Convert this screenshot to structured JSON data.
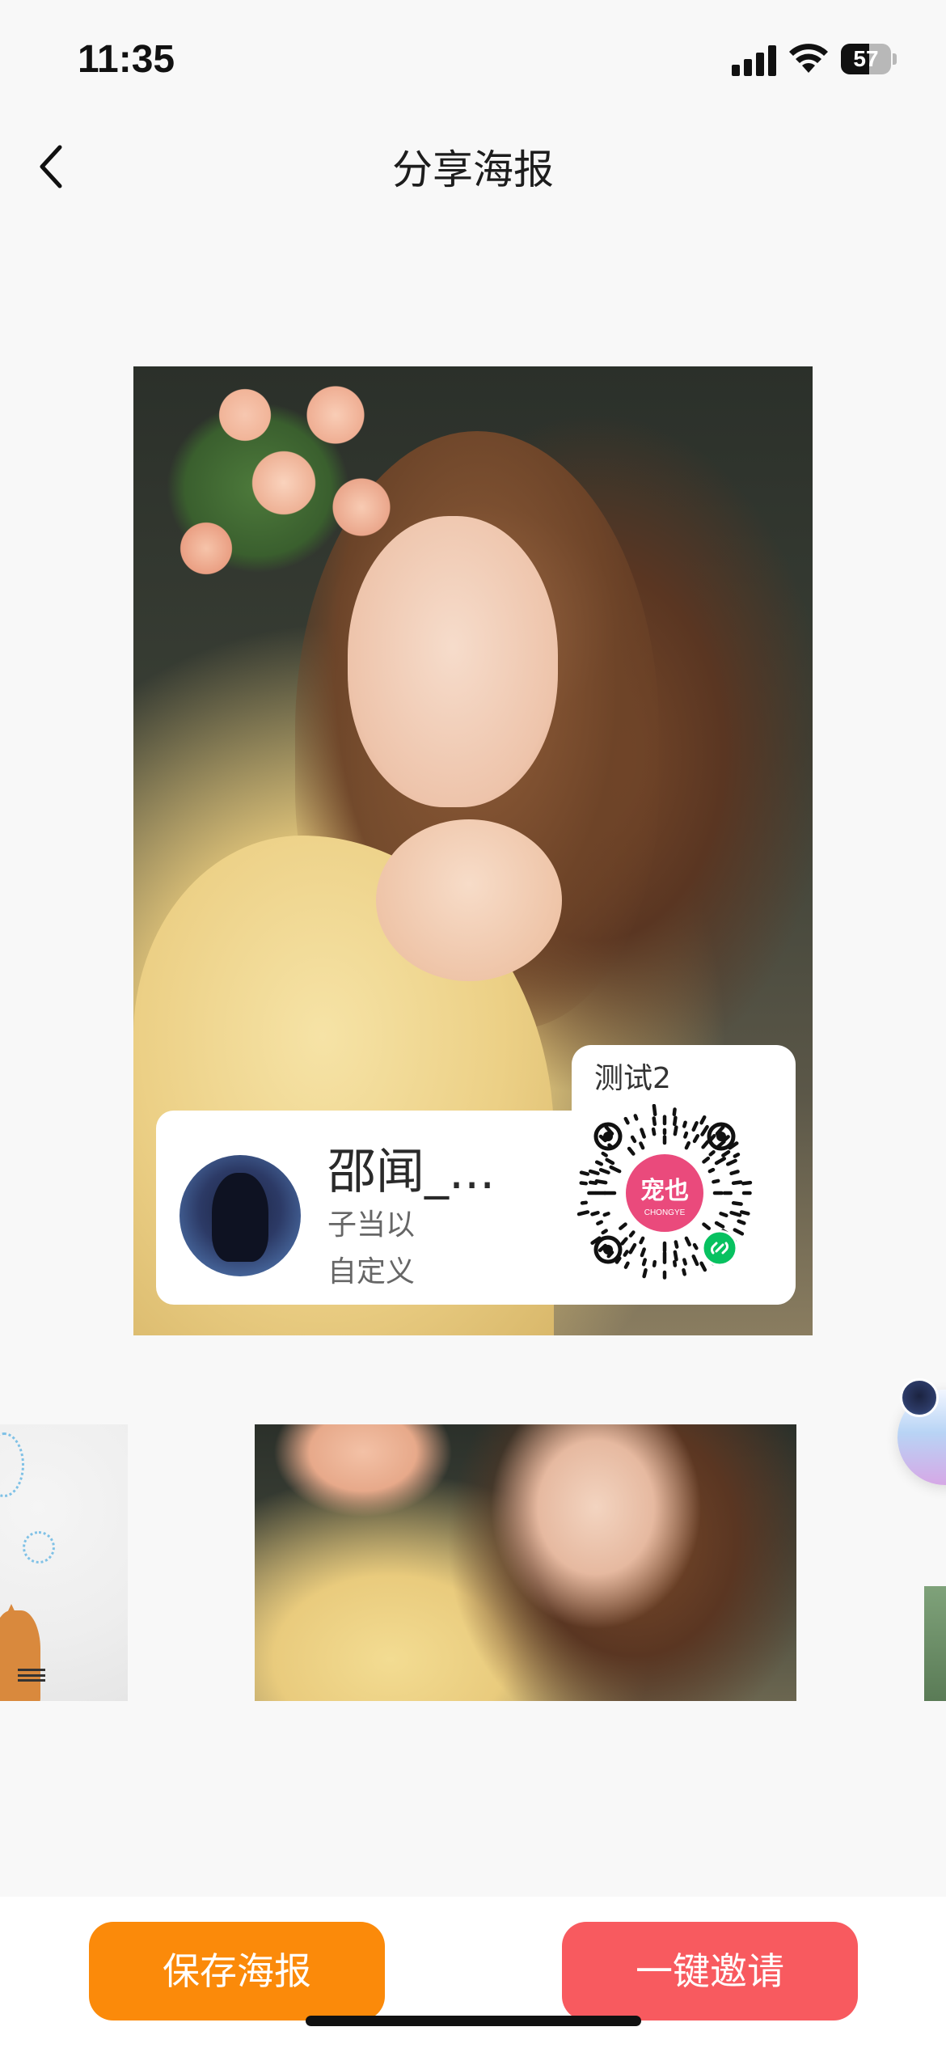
{
  "status_bar": {
    "time": "11:35",
    "battery_level": "57",
    "icons": [
      "signal-icon",
      "wifi-icon",
      "battery-icon"
    ]
  },
  "nav": {
    "title": "分享海报",
    "back_icon": "chevron-left-icon"
  },
  "poster": {
    "qr_label": "测试2",
    "user_name": "邵闻_...",
    "user_line1": "子当以",
    "user_line2": "自定义",
    "qr_logo_text": "宠也",
    "qr_logo_subtext": "CHONGYE",
    "qr_badge_icon": "mini-program-link-icon"
  },
  "templates": {
    "selected": "photo-template"
  },
  "actions": {
    "save_label": "保存海报",
    "invite_label": "一键邀请"
  },
  "colors": {
    "save_button": "#fb8a0a",
    "invite_button": "#f85a5f",
    "qr_logo": "#ea4a7c",
    "qr_badge": "#07c160"
  }
}
